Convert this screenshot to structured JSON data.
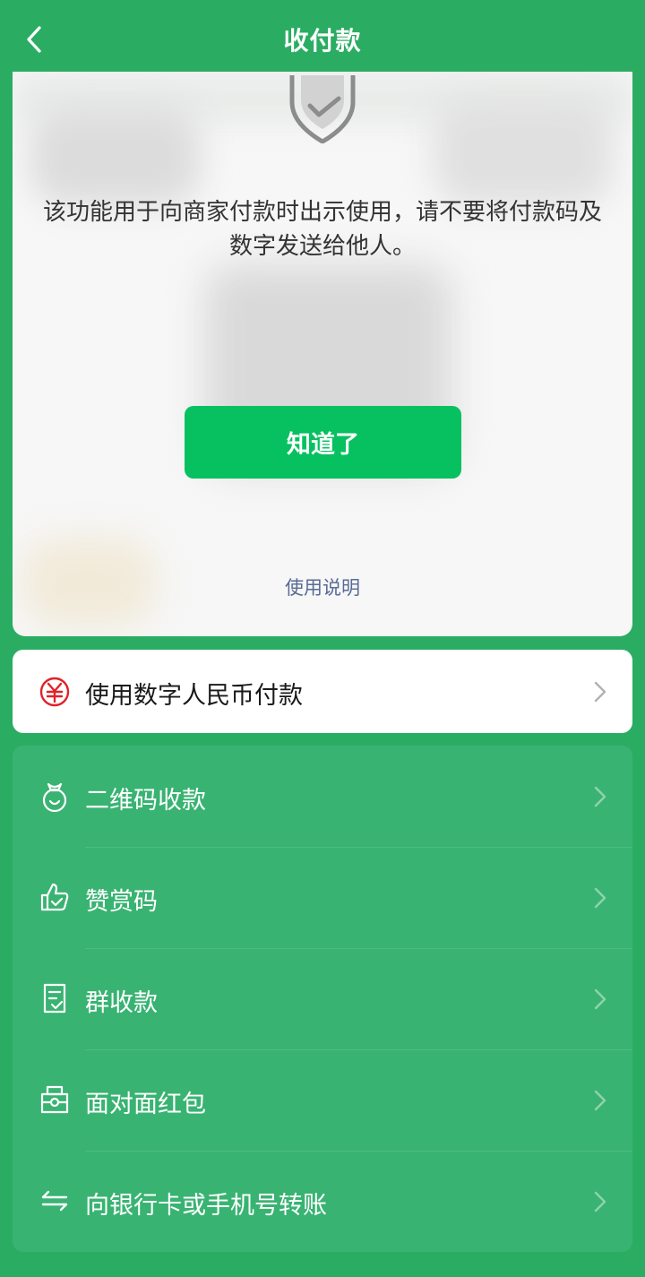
{
  "header": {
    "title": "收付款"
  },
  "pay_card": {
    "warning_text": "该功能用于向商家付款时出示使用，请不要将付款码及数字发送给他人。",
    "ok_button_label": "知道了",
    "usage_link_label": "使用说明"
  },
  "digital_rmb": {
    "label": "使用数字人民币付款"
  },
  "menu": {
    "items": [
      {
        "label": "二维码收款",
        "icon": "money-bag-icon"
      },
      {
        "label": "赞赏码",
        "icon": "thumbs-up-icon"
      },
      {
        "label": "群收款",
        "icon": "group-bill-icon"
      },
      {
        "label": "面对面红包",
        "icon": "red-packet-icon"
      },
      {
        "label": "向银行卡或手机号转账",
        "icon": "transfer-arrows-icon"
      }
    ]
  },
  "colors": {
    "background": "#2aad62",
    "accent_button": "#07c160",
    "link": "#576b95",
    "rmb_icon": "#e0222a"
  }
}
